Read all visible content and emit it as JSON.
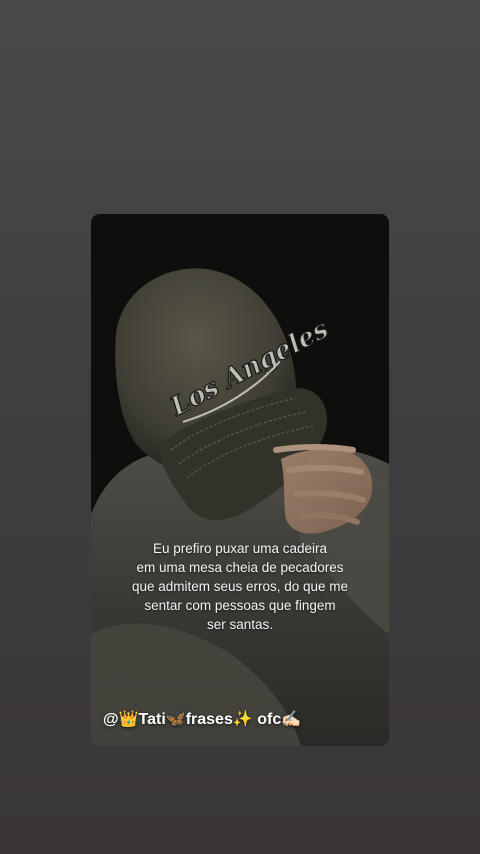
{
  "story": {
    "quote": "Eu prefiro puxar uma cadeira\nem uma mesa cheia de pecadores\nque admitem seus erros, do que me\nsentar com pessoas que fingem\nser santas.",
    "watermark": "@👑Tati🦋frases✨ ofc✍🏻",
    "cap_logo_text": "Los Angeles"
  },
  "colors": {
    "page_background": "#434244",
    "card_background": "#111110",
    "text": "#f2f2f2"
  }
}
